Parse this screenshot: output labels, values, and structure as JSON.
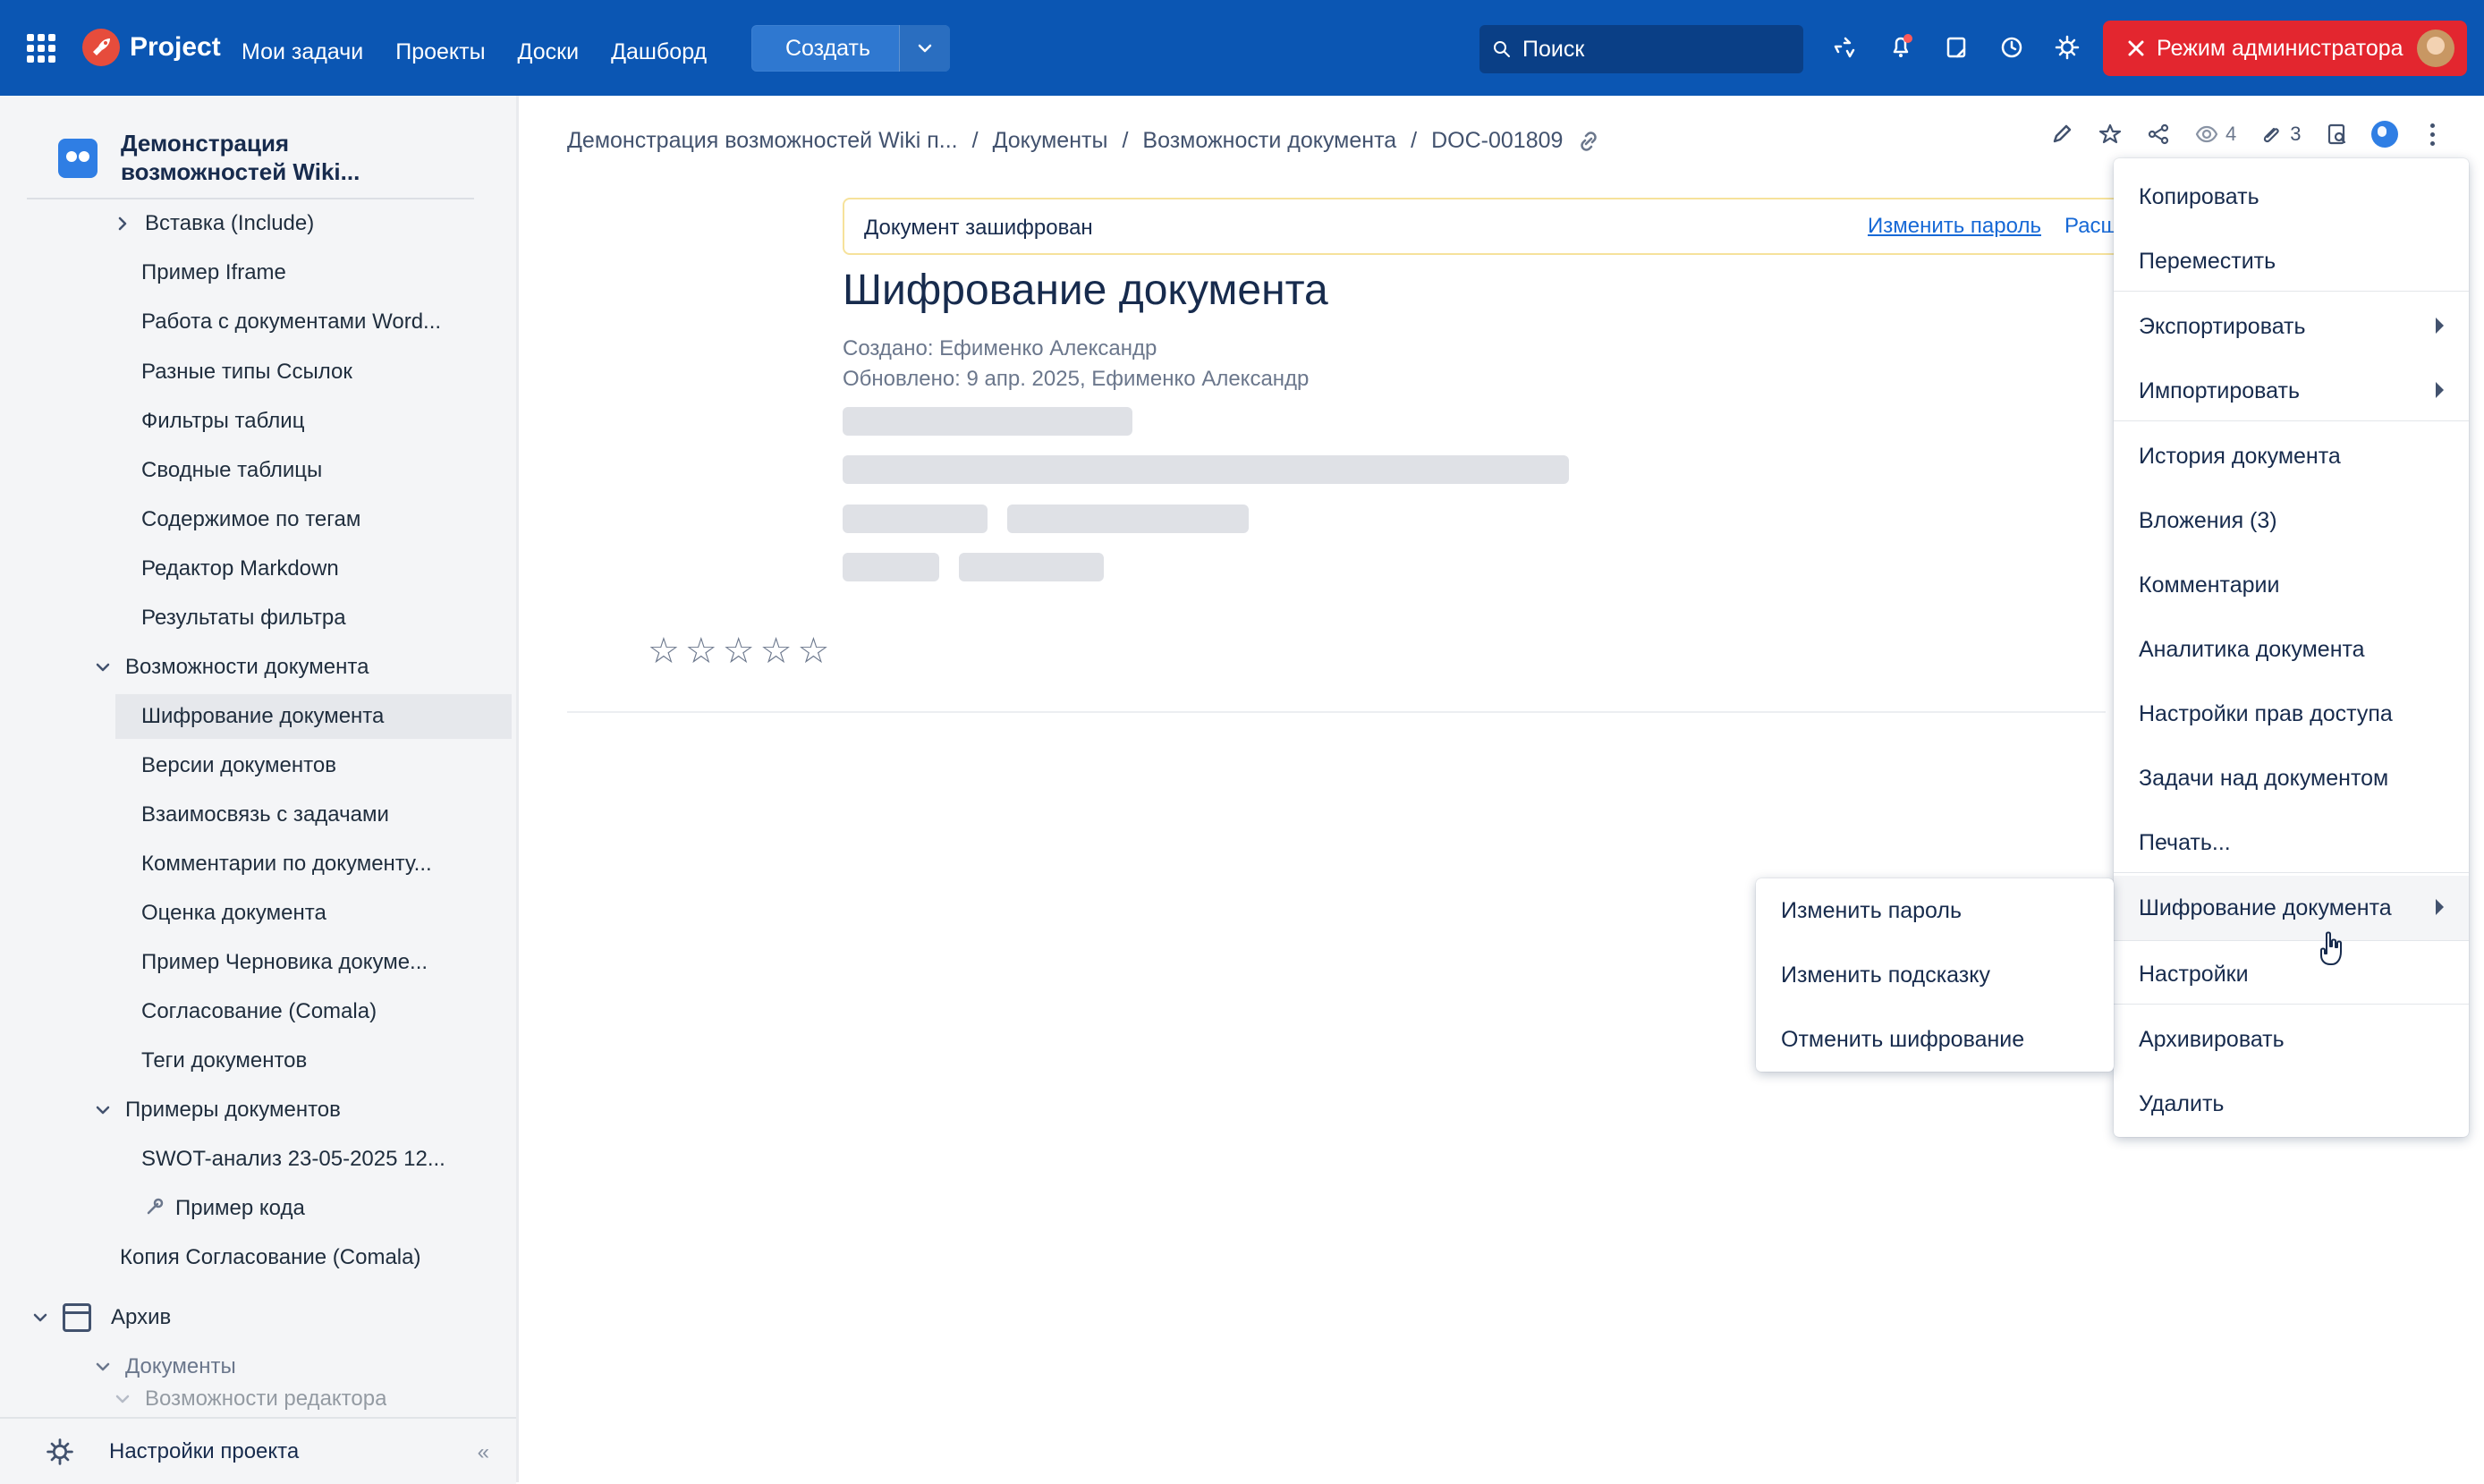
{
  "topbar": {
    "brand": "Project",
    "nav": [
      "Мои задачи",
      "Проекты",
      "Доски",
      "Дашборд"
    ],
    "create_label": "Создать",
    "search_placeholder": "Поиск",
    "admin_label": "Режим администратора"
  },
  "sidebar": {
    "space_name_line1": "Демонстрация",
    "space_name_line2": "возможностей Wiki...",
    "tree": [
      "Вставка (Include)",
      "Пример Iframe",
      "Работа с документами Word...",
      "Разные типы Ссылок",
      "Фильтры таблиц",
      "Сводные таблицы",
      "Содержимое по тегам",
      "Редактор Markdown",
      "Результаты фильтра",
      "Возможности документа",
      "Шифрование документа",
      "Версии документов",
      "Взаимосвязь с задачами",
      "Комментарии по документу...",
      "Оценка документа",
      "Пример Черновика докуме...",
      "Согласование (Comala)",
      "Теги документов",
      "Примеры документов",
      "SWOT-анализ 23-05-2025 12...",
      "Пример кода",
      "Копия Согласование (Comala)",
      "Архив",
      "Документы",
      "Возможности редактора"
    ],
    "footer_label": "Настройки проекта"
  },
  "main": {
    "breadcrumb": {
      "part1": "Демонстрация возможностей Wiki п...",
      "part2": "Документы",
      "part3": "Возможности документа",
      "part4": "DOC-001809"
    },
    "actions": {
      "views_count": "4",
      "attachments_count": "3"
    },
    "banner": {
      "text": "Документ зашифрован",
      "link_change_password": "Изменить пароль",
      "link_more": "Расш"
    },
    "title": "Шифрование документа",
    "meta": {
      "created": "Создано: Ефименко Александр",
      "updated": "Обновлено: 9 апр. 2025, Ефименко Александр"
    },
    "stars": "☆☆☆☆☆"
  },
  "menu": {
    "items": [
      "Копировать",
      "Переместить",
      "Экспортировать",
      "Импортировать",
      "История документа",
      "Вложения (3)",
      "Комментарии",
      "Аналитика документа",
      "Настройки прав доступа",
      "Задачи над документом",
      "Печать...",
      "Шифрование документа",
      "Настройки",
      "Архивировать",
      "Удалить"
    ],
    "submenu": [
      "Изменить пароль",
      "Изменить подсказку",
      "Отменить шифрование"
    ]
  },
  "colors": {
    "topbar": "#0b56b3",
    "admin": "#e3262f"
  }
}
